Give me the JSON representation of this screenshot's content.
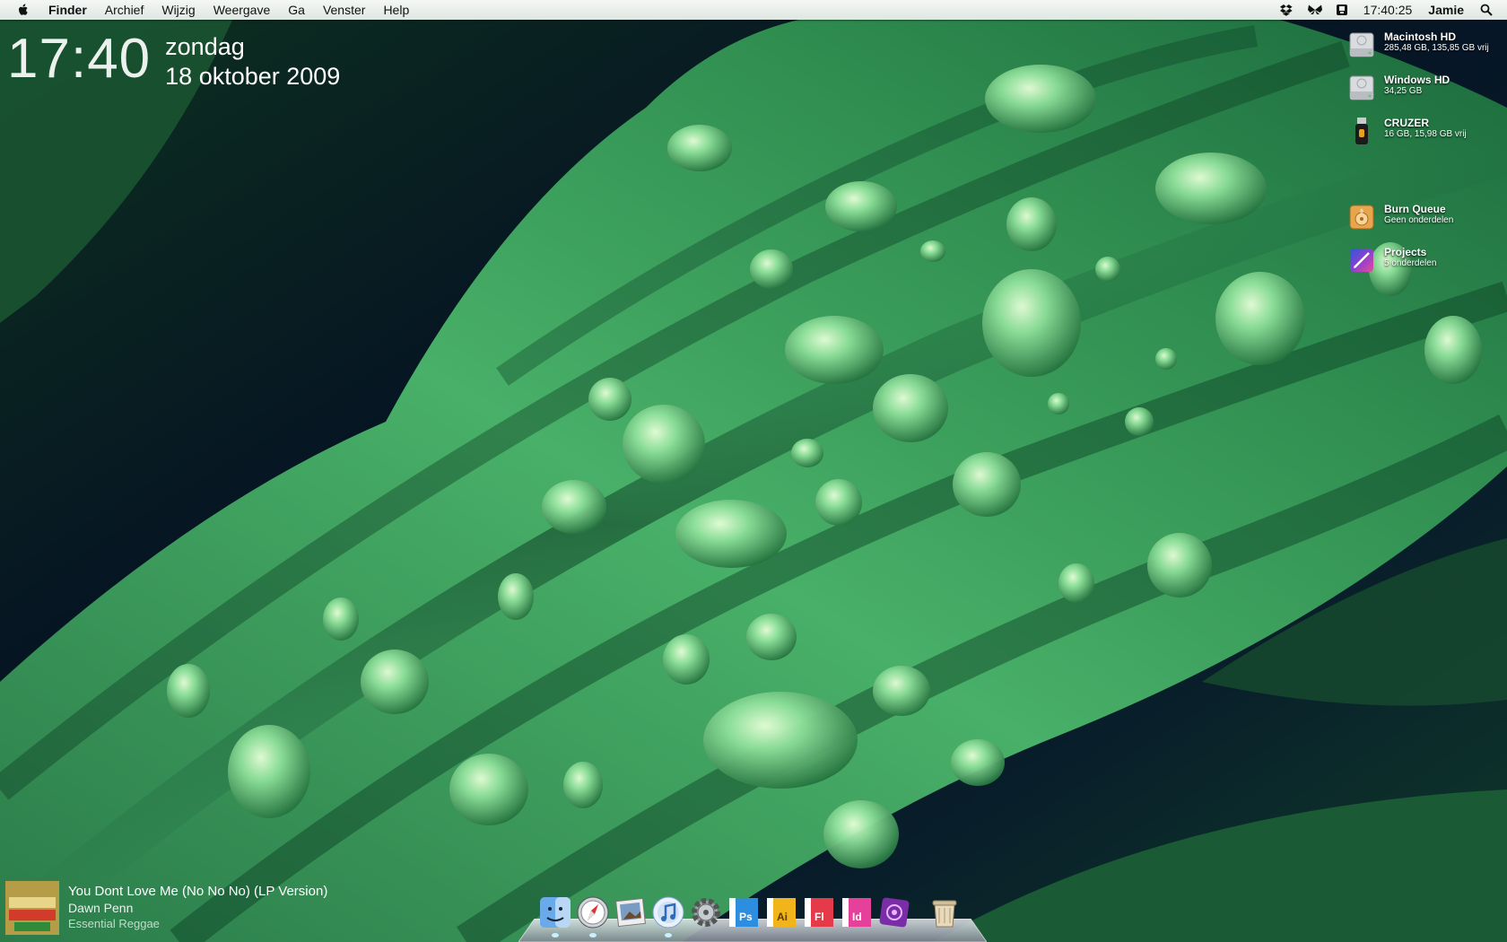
{
  "menubar": {
    "apple_icon": "apple-logo-icon",
    "app_name": "Finder",
    "menus": [
      "Archief",
      "Wijzig",
      "Weergave",
      "Ga",
      "Venster",
      "Help"
    ],
    "status_icons": [
      "dropbox-icon",
      "bluetooth-butterfly-icon",
      "display-icon"
    ],
    "clock": "17:40:25",
    "user": "Jamie",
    "spotlight_icon": "search-icon"
  },
  "clock_widget": {
    "time": "17:40",
    "day": "zondag",
    "date": "18 oktober 2009"
  },
  "desktop_icons": [
    {
      "name": "Macintosh HD",
      "detail": "285,48 GB, 135,85 GB vrij",
      "icon": "hard-drive-icon"
    },
    {
      "name": "Windows HD",
      "detail": "34,25 GB",
      "icon": "hard-drive-icon"
    },
    {
      "name": "CRUZER",
      "detail": "16 GB, 15,98 GB vrij",
      "icon": "usb-drive-icon"
    },
    {
      "name": "Burn Queue",
      "detail": "Geen onderdelen",
      "icon": "burn-folder-icon"
    },
    {
      "name": "Projects",
      "detail": "5 onderdelen",
      "icon": "projects-folder-icon"
    }
  ],
  "now_playing": {
    "track": "You Dont Love Me (No No No) (LP Version)",
    "artist": "Dawn Penn",
    "album": "Essential Reggae",
    "cover_text": "ESSENTIAL REGGAE",
    "cover_icon": "album-cover-icon"
  },
  "dock": {
    "apps": [
      {
        "name": "Finder",
        "icon": "finder-icon",
        "running": true
      },
      {
        "name": "Safari",
        "icon": "safari-compass-icon",
        "running": true
      },
      {
        "name": "Preview",
        "icon": "preview-icon",
        "running": false
      },
      {
        "name": "iTunes",
        "icon": "itunes-icon",
        "running": true
      },
      {
        "name": "System Preferences",
        "icon": "gear-icon",
        "running": false
      },
      {
        "name": "Photoshop",
        "icon": "photoshop-icon",
        "label": "Ps",
        "running": false
      },
      {
        "name": "Illustrator",
        "icon": "illustrator-icon",
        "label": "Ai",
        "running": false
      },
      {
        "name": "Flash",
        "icon": "flash-icon",
        "label": "Fl",
        "running": false
      },
      {
        "name": "InDesign",
        "icon": "indesign-icon",
        "label": "Id",
        "running": false
      },
      {
        "name": "Rings app",
        "icon": "purple-app-icon",
        "running": false
      },
      {
        "name": "Trash",
        "icon": "trash-icon",
        "running": false
      }
    ]
  },
  "colors": {
    "leaf_light": "#5fc77a",
    "leaf_mid": "#2d8f4f",
    "leaf_dark": "#0e3b25",
    "background_dark": "#061320",
    "menubar": "#eef2ef"
  }
}
